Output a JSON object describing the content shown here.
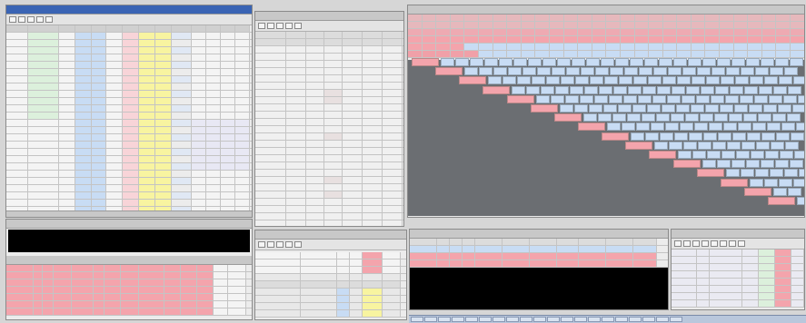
{
  "windows": {
    "left_top": {
      "title": "",
      "toolbar_buttons": 5
    },
    "left_bottom": {
      "title": ""
    },
    "middle_top": {
      "title": "",
      "toolbar_buttons": 5
    },
    "middle_bottom": {
      "title": "",
      "toolbar_buttons": 5
    },
    "right_top": {
      "title": ""
    },
    "right_bottom_center": {
      "title": ""
    },
    "right_bottom_right": {
      "title": "",
      "toolbar_buttons": 8
    }
  },
  "colors": {
    "pink": "#f4a4ac",
    "light_pink": "#f8d4d8",
    "light_blue": "#c8dcf4",
    "light_green": "#dcf0dc",
    "yellow": "#f8f4a0",
    "gray_bg": "#6b6e72",
    "black": "#000000",
    "title_blue": "#3a64b4"
  },
  "taskbar": {
    "buttons": 20
  }
}
